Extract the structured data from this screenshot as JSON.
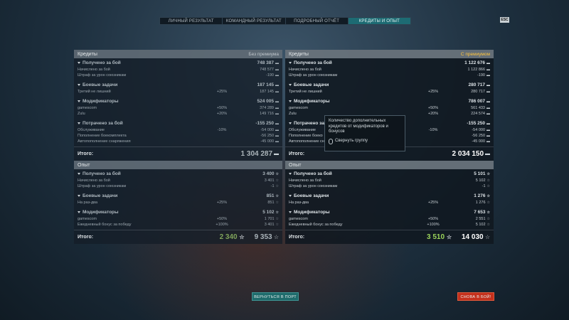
{
  "tabs": [
    "ЛИЧНЫЙ РЕЗУЛЬТАТ",
    "КОМАНДНЫЙ РЕЗУЛЬТАТ",
    "ПОДРОБНЫЙ ОТЧЁТ",
    "КРЕДИТЫ И ОПЫТ"
  ],
  "active_tab": 3,
  "esc_label": "ESC",
  "left": {
    "credits_title": "Кредиты",
    "credits_premium": "Без премиума",
    "groups": [
      {
        "title": "Получено за бой",
        "value": "748 387",
        "rows": [
          {
            "name": "Начислено за бой",
            "pct": "",
            "value": "748 577"
          },
          {
            "name": "Штраф за урон союзникам",
            "pct": "",
            "value": "-190"
          }
        ]
      },
      {
        "title": "Боевые задачи",
        "value": "187 145",
        "rows": [
          {
            "name": "Третий не лишний",
            "pct": "+25%",
            "value": "187 145"
          }
        ]
      },
      {
        "title": "Модификаторы",
        "value": "524 005",
        "rows": [
          {
            "name": "gamescom",
            "pct": "+50%",
            "value": "374 289"
          },
          {
            "name": "Zulu",
            "pct": "+20%",
            "value": "149 716"
          }
        ]
      },
      {
        "title": "Потрачено за бой",
        "value": "-155 250",
        "rows": [
          {
            "name": "Обслуживание",
            "pct": "-10%",
            "value": "-54 000"
          },
          {
            "name": "Пополнение боекомплекта",
            "pct": "",
            "value": "-56 250"
          },
          {
            "name": "Автопополнение снаряжения",
            "pct": "",
            "value": "-45 000"
          }
        ]
      }
    ],
    "total_label": "Итого:",
    "total_credits": "1 304 287",
    "xp_title": "Опыт",
    "xp_groups": [
      {
        "title": "Получено за бой",
        "value": "3 400",
        "rows": [
          {
            "name": "Начислено за бой",
            "pct": "",
            "value": "3 401"
          },
          {
            "name": "Штраф за урон союзникам",
            "pct": "",
            "value": "-1"
          }
        ]
      },
      {
        "title": "Боевые задачи",
        "value": "851",
        "rows": [
          {
            "name": "На раз-два",
            "pct": "+25%",
            "value": "851"
          }
        ]
      },
      {
        "title": "Модификаторы",
        "value": "5 102",
        "rows": [
          {
            "name": "gamescom",
            "pct": "+50%",
            "value": "1 701"
          },
          {
            "name": "Ежедневный бонус за победу",
            "pct": "+100%",
            "value": "3 401"
          }
        ]
      }
    ],
    "xp_total_label": "Итого:",
    "xp_free": "2 340",
    "xp_total": "9 353"
  },
  "right": {
    "credits_title": "Кредиты",
    "credits_premium": "С премиумом",
    "groups": [
      {
        "title": "Получено за бой",
        "value": "1 122 676",
        "rows": [
          {
            "name": "Начислено за бой",
            "pct": "",
            "value": "1 122 866"
          },
          {
            "name": "Штраф за урон союзникам",
            "pct": "",
            "value": "-190"
          }
        ]
      },
      {
        "title": "Боевые задачи",
        "value": "280 717",
        "rows": [
          {
            "name": "Третий не лишний",
            "pct": "+25%",
            "value": "280 717"
          }
        ]
      },
      {
        "title": "Модификаторы",
        "value": "786 007",
        "rows": [
          {
            "name": "gamescom",
            "pct": "+50%",
            "value": "561 433"
          },
          {
            "name": "Zulu",
            "pct": "+20%",
            "value": "224 574"
          }
        ]
      },
      {
        "title": "Потрачено за",
        "value": "-155 250",
        "rows": [
          {
            "name": "Обслуживание",
            "pct": "-10%",
            "value": "-54 000"
          },
          {
            "name": "Пополнение боеко",
            "pct": "",
            "value": "-56 250"
          },
          {
            "name": "Автопополнение сн",
            "pct": "",
            "value": "-45 000"
          }
        ]
      }
    ],
    "total_label": "Итого:",
    "total_credits": "2 034 150",
    "xp_title": "Опыт",
    "xp_groups": [
      {
        "title": "Получено за бой",
        "value": "5 101",
        "rows": [
          {
            "name": "Начислено за бой",
            "pct": "",
            "value": "5 102"
          },
          {
            "name": "Штраф за урон союзникам",
            "pct": "",
            "value": "-1"
          }
        ]
      },
      {
        "title": "Боевые задачи",
        "value": "1 276",
        "rows": [
          {
            "name": "На раз-два",
            "pct": "+25%",
            "value": "1 276"
          }
        ]
      },
      {
        "title": "Модификаторы",
        "value": "7 653",
        "rows": [
          {
            "name": "gamescom",
            "pct": "+50%",
            "value": "2 551"
          },
          {
            "name": "Ежедневный бонус за победу",
            "pct": "+100%",
            "value": "5 102"
          }
        ]
      }
    ],
    "xp_total_label": "Итого:",
    "xp_free": "3 510",
    "xp_total": "14 030"
  },
  "tooltip": {
    "text": "Количество дополнительных кредитов от модификаторов и бонусов",
    "action": "Свернуть группу"
  },
  "buttons": {
    "port": "ВЕРНУТЬСЯ В ПОРТ",
    "battle": "СНОВА В БОЙ!"
  }
}
